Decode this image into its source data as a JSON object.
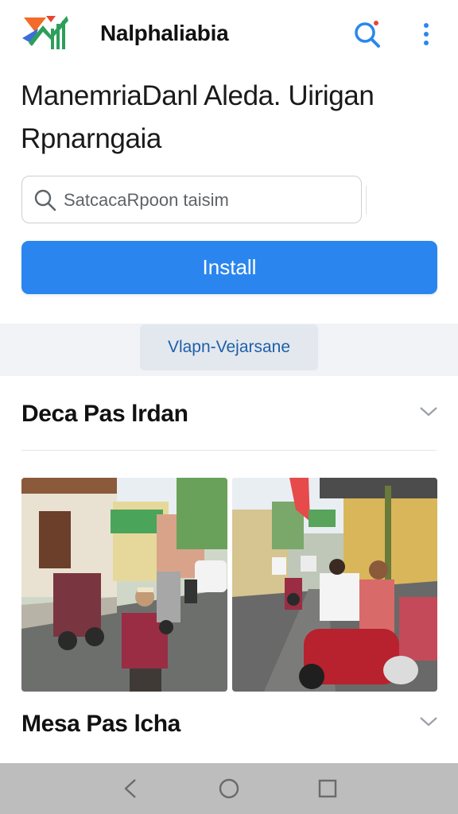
{
  "app_bar": {
    "app_name": "Nalphaliabia",
    "logo_icon": "chart-logo-icon",
    "search_icon": "search-icon",
    "more_icon": "more-vert-icon",
    "accent": "#2a86ee"
  },
  "page": {
    "title_line1": "ManemriaDanl Aleda. Uirigan",
    "title_line2": "Rpnarngaia"
  },
  "search": {
    "placeholder": "SatcacaRpoon taisim"
  },
  "install": {
    "label": "Install",
    "color": "#2a86ee"
  },
  "chip": {
    "label": "Vlapn-Vejarsane"
  },
  "sections": [
    {
      "label": "Deca Pas lrdan",
      "expand_icon": "chevron-down-icon"
    },
    {
      "label": "Mesa Pas lcha",
      "expand_icon": "chevron-down-icon"
    }
  ],
  "gallery": [
    {
      "alt": "street-photo-left"
    },
    {
      "alt": "street-photo-right"
    }
  ],
  "system_nav": {
    "back_icon": "back-triangle-icon",
    "home_icon": "home-circle-icon",
    "recents_icon": "recents-square-icon"
  }
}
